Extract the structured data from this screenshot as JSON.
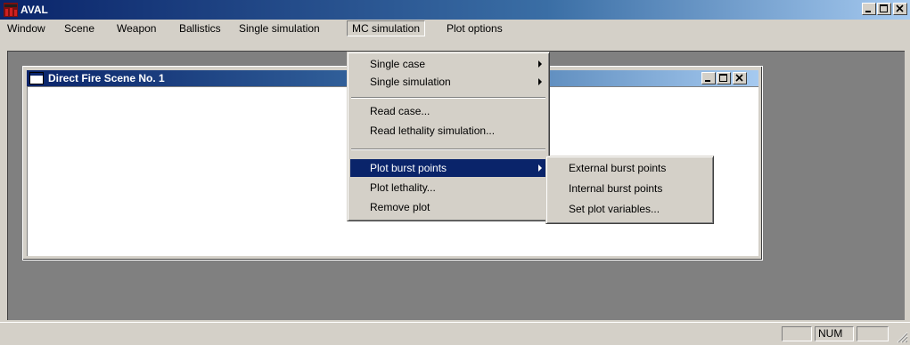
{
  "window": {
    "title": "AVAL"
  },
  "menubar": {
    "items": [
      {
        "label": "Window"
      },
      {
        "label": "Scene"
      },
      {
        "label": "Weapon"
      },
      {
        "label": "Ballistics"
      },
      {
        "label": "Single simulation"
      },
      {
        "label": "MC simulation"
      },
      {
        "label": "Plot options"
      }
    ]
  },
  "child_window": {
    "title": "Direct Fire Scene No. 1"
  },
  "mc_menu": {
    "items": [
      {
        "label": "Single case"
      },
      {
        "label": "Single simulation"
      },
      {
        "label": "Read case..."
      },
      {
        "label": "Read lethality simulation..."
      },
      {
        "label": "Plot burst points"
      },
      {
        "label": "Plot lethality..."
      },
      {
        "label": "Remove plot"
      }
    ]
  },
  "burst_submenu": {
    "items": [
      {
        "label": "External burst points"
      },
      {
        "label": "Internal burst points"
      },
      {
        "label": "Set plot variables..."
      }
    ]
  },
  "statusbar": {
    "num": "NUM"
  },
  "colors": {
    "titlebar_start": "#0a246a",
    "titlebar_end": "#a6caf0",
    "highlight": "#0a246a",
    "face": "#d4d0c8"
  }
}
